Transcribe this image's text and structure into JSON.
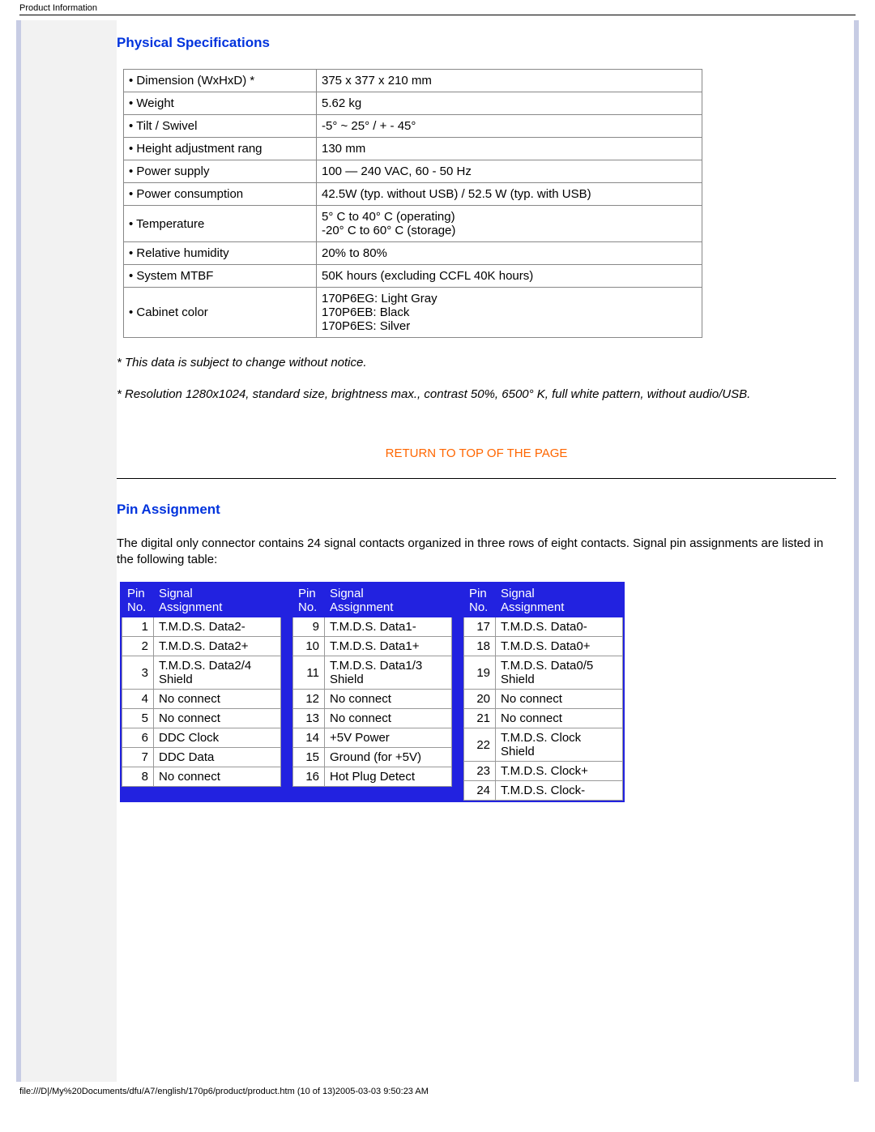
{
  "header": "Product Information",
  "section1_title": "Physical Specifications",
  "spec_rows": [
    {
      "label": "• Dimension (WxHxD) *",
      "value": "375 x 377 x 210 mm"
    },
    {
      "label": "• Weight",
      "value": "5.62 kg"
    },
    {
      "label": "• Tilt / Swivel",
      "value": "-5° ~ 25° / + - 45°"
    },
    {
      "label": "• Height adjustment rang",
      "value": "130 mm"
    },
    {
      "label": "• Power supply",
      "value": "100 — 240 VAC, 60 - 50 Hz"
    },
    {
      "label": "• Power consumption",
      "value": "42.5W (typ. without USB) / 52.5 W (typ. with USB)"
    },
    {
      "label": "• Temperature",
      "value": "5° C to 40° C (operating)\n-20° C to 60° C (storage)"
    },
    {
      "label": "• Relative humidity",
      "value": "20% to 80%"
    },
    {
      "label": "• System MTBF",
      "value": "50K hours (excluding CCFL 40K hours)"
    },
    {
      "label": "• Cabinet color",
      "value": "170P6EG: Light Gray\n170P6EB: Black\n170P6ES: Silver"
    }
  ],
  "note1": "* This data is subject to change without notice.",
  "note2": "* Resolution 1280x1024, standard size, brightness max., contrast 50%, 6500° K, full white pattern, without audio/USB.",
  "return_link": "RETURN TO TOP OF THE PAGE",
  "section2_title": "Pin Assignment",
  "pin_desc": "The digital only connector contains 24 signal contacts organized in three rows of eight contacts. Signal pin assignments are listed in the following table:",
  "pin_headers": {
    "col1": "Pin No.",
    "col2": "Signal Assignment"
  },
  "pin_groups": [
    [
      {
        "no": "1",
        "sig": "T.M.D.S. Data2-"
      },
      {
        "no": "2",
        "sig": "T.M.D.S. Data2+"
      },
      {
        "no": "3",
        "sig": "T.M.D.S. Data2/4 Shield"
      },
      {
        "no": "4",
        "sig": "No connect"
      },
      {
        "no": "5",
        "sig": "No connect"
      },
      {
        "no": "6",
        "sig": "DDC Clock"
      },
      {
        "no": "7",
        "sig": "DDC Data"
      },
      {
        "no": "8",
        "sig": "No connect"
      }
    ],
    [
      {
        "no": "9",
        "sig": "T.M.D.S. Data1-"
      },
      {
        "no": "10",
        "sig": "T.M.D.S. Data1+"
      },
      {
        "no": "11",
        "sig": "T.M.D.S. Data1/3 Shield"
      },
      {
        "no": "12",
        "sig": "No connect"
      },
      {
        "no": "13",
        "sig": "No connect"
      },
      {
        "no": "14",
        "sig": "+5V Power"
      },
      {
        "no": "15",
        "sig": "Ground (for +5V)"
      },
      {
        "no": "16",
        "sig": "Hot Plug Detect"
      }
    ],
    [
      {
        "no": "17",
        "sig": "T.M.D.S. Data0-"
      },
      {
        "no": "18",
        "sig": "T.M.D.S. Data0+"
      },
      {
        "no": "19",
        "sig": "T.M.D.S. Data0/5 Shield"
      },
      {
        "no": "20",
        "sig": "No connect"
      },
      {
        "no": "21",
        "sig": "No connect"
      },
      {
        "no": "22",
        "sig": "T.M.D.S. Clock Shield"
      },
      {
        "no": "23",
        "sig": "T.M.D.S. Clock+"
      },
      {
        "no": "24",
        "sig": "T.M.D.S. Clock-"
      }
    ]
  ],
  "footer": "file:///D|/My%20Documents/dfu/A7/english/170p6/product/product.htm (10 of 13)2005-03-03 9:50:23 AM"
}
